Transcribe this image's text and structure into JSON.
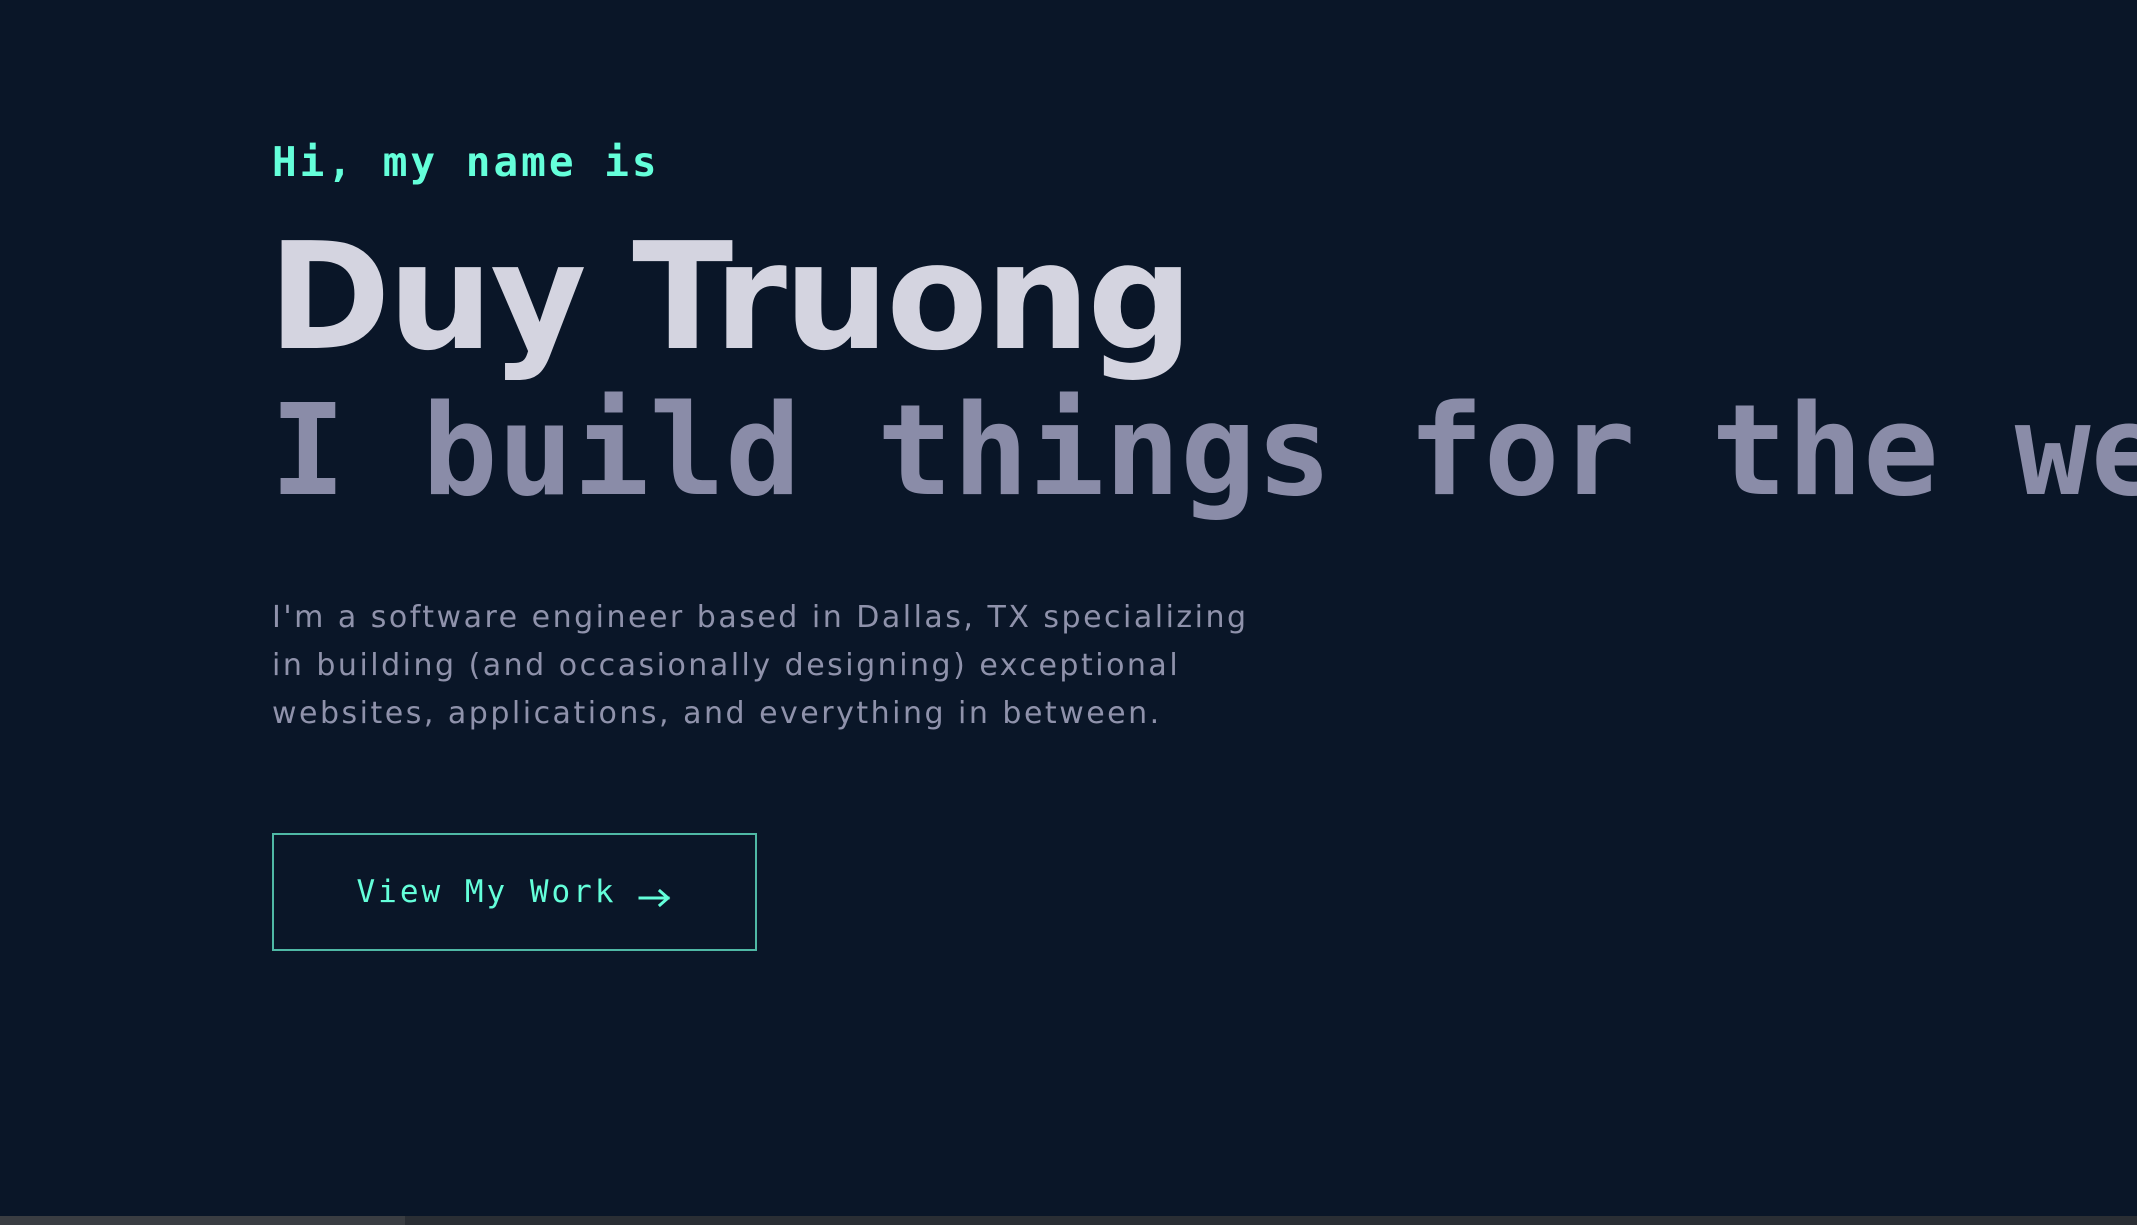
{
  "hero": {
    "intro": "Hi, my name is",
    "name": "Duy Truong",
    "tagline": "I build things for the web",
    "description": "I'm a software engineer based in Dallas, TX specializing in building (and occasionally designing) exceptional websites, applications, and everything in between.",
    "cta_label": "View My Work",
    "cta_icon": "arrow-right-icon"
  },
  "colors": {
    "background": "#0a1628",
    "accent": "#64ffda",
    "name": "#d4d4e0",
    "tagline": "#8a8ca8",
    "body_text": "#8f92ab",
    "button_border": "#4fb8a5"
  }
}
